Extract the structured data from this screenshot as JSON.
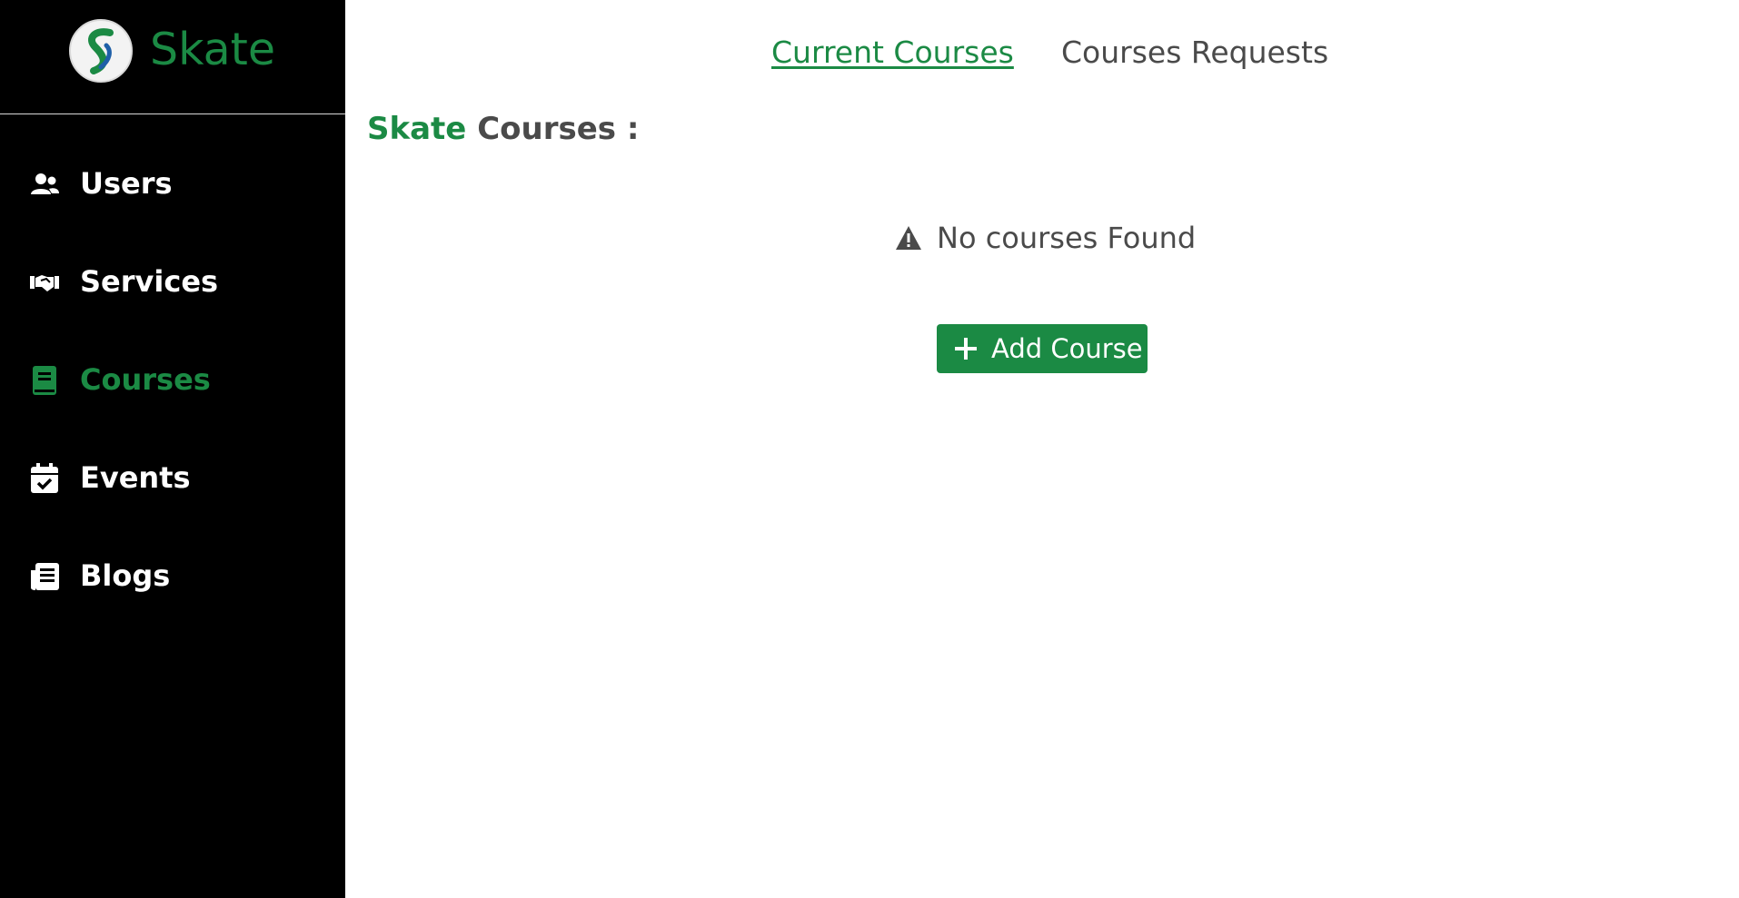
{
  "brand": {
    "name": "Skate",
    "logo_icon": "skate-s-logo-icon"
  },
  "sidebar": {
    "items": [
      {
        "label": "Users",
        "icon": "users-icon",
        "active": false
      },
      {
        "label": "Services",
        "icon": "handshake-icon",
        "active": false
      },
      {
        "label": "Courses",
        "icon": "book-icon",
        "active": true
      },
      {
        "label": "Events",
        "icon": "calendar-check-icon",
        "active": false
      },
      {
        "label": "Blogs",
        "icon": "newspaper-icon",
        "active": false
      }
    ]
  },
  "tabs": {
    "current": "Current Courses",
    "requests": "Courses Requests"
  },
  "section": {
    "title_accent": "Skate",
    "title_rest": " Courses :"
  },
  "empty_state": {
    "icon": "warning-icon",
    "text": "No courses Found"
  },
  "actions": {
    "add_course_label": "Add Course",
    "add_icon": "plus-icon"
  },
  "colors": {
    "accent": "#1b8a44",
    "sidebar_bg": "#000000",
    "text_muted": "#4a4a4a"
  }
}
